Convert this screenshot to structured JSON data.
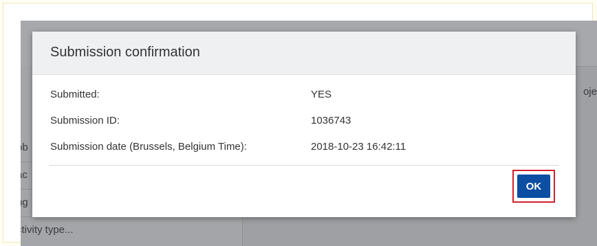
{
  "background": {
    "rows": [
      "ob",
      "ac",
      "ng",
      "ctivity type..."
    ],
    "right_text": "oje"
  },
  "modal": {
    "title": "Submission confirmation",
    "fields": [
      {
        "label": "Submitted:",
        "value": "YES"
      },
      {
        "label": "Submission ID:",
        "value": "1036743"
      },
      {
        "label": "Submission date (Brussels, Belgium Time):",
        "value": "2018-10-23 16:42:11"
      }
    ],
    "ok_label": "OK"
  },
  "colors": {
    "primary_button": "#0b4ea2",
    "highlight_border": "#d0212c",
    "overlay": "#9ea0a3"
  }
}
